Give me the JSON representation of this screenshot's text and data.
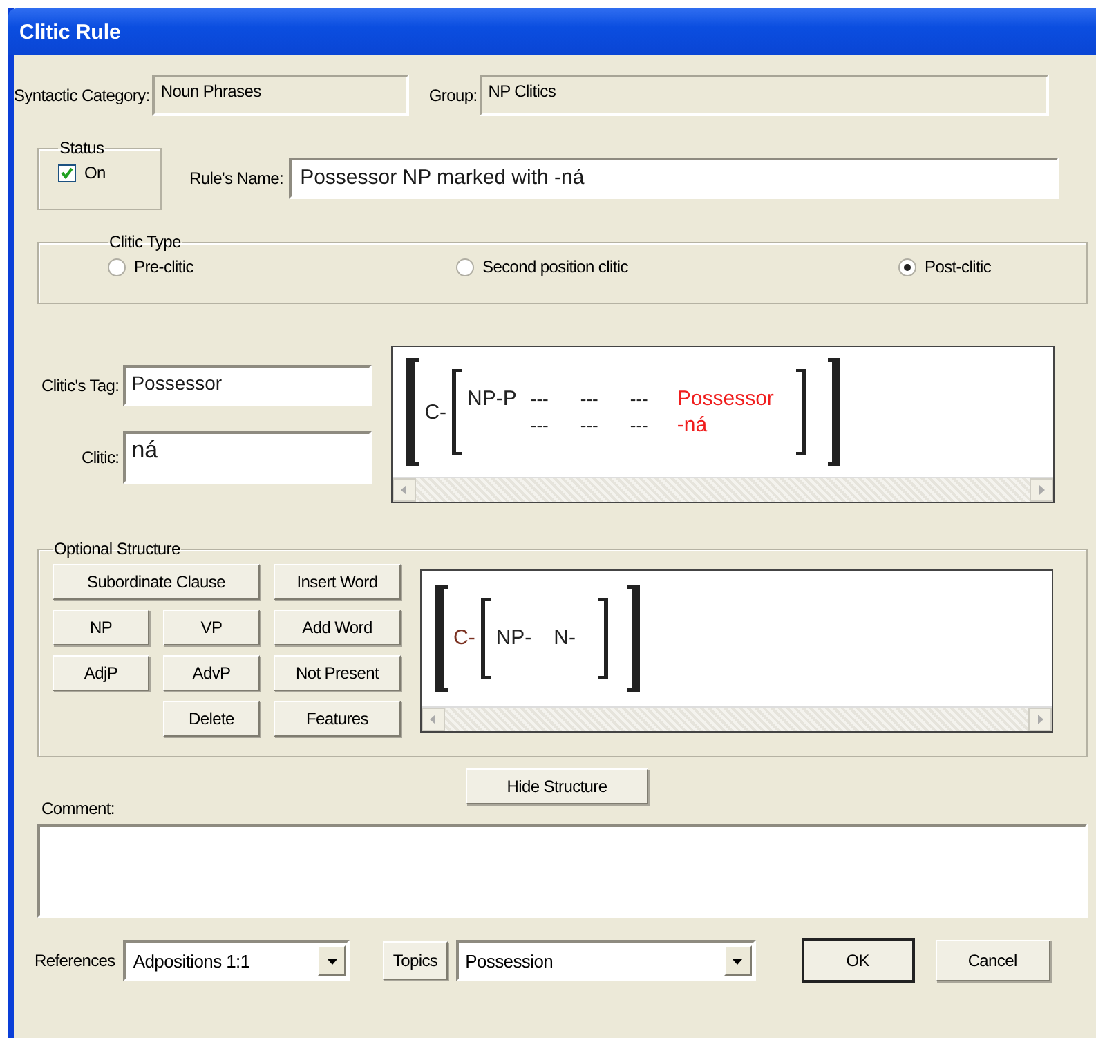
{
  "window": {
    "title": "Clitic Rule"
  },
  "syntactic_category": {
    "label": "Syntactic Category:",
    "value": "Noun Phrases"
  },
  "group": {
    "label": "Group:",
    "value": "NP Clitics"
  },
  "status": {
    "legend": "Status",
    "checkbox": {
      "label": "On",
      "checked": true
    }
  },
  "rule_name": {
    "label": "Rule's Name:",
    "value": "Possessor NP marked with -ná"
  },
  "clitic_type": {
    "legend": "Clitic Type",
    "options": [
      {
        "label": "Pre-clitic",
        "selected": false
      },
      {
        "label": "Second position clitic",
        "selected": false
      },
      {
        "label": "Post-clitic",
        "selected": true
      }
    ]
  },
  "clitic_tag": {
    "label": "Clitic's Tag:",
    "value": "Possessor"
  },
  "clitic": {
    "label": "Clitic:",
    "value": "ná"
  },
  "structure": {
    "outer_label": "C-",
    "phrase_label": "NP-P",
    "rows": [
      {
        "cells": [
          "---",
          "---",
          "---"
        ],
        "word": "Possessor"
      },
      {
        "cells": [
          "---",
          "---",
          "---"
        ],
        "word": "-ná"
      }
    ]
  },
  "optional_structure": {
    "legend": "Optional Structure",
    "buttons": [
      "Subordinate Clause",
      "Insert Word",
      "NP",
      "VP",
      "Add Word",
      "AdjP",
      "AdvP",
      "Not Present",
      "Delete",
      "Features"
    ],
    "structure": {
      "outer_label": "C-",
      "phrase_label": "NP-",
      "head_label": "N-"
    }
  },
  "hide_structure_button": "Hide Structure",
  "comment": {
    "label": "Comment:"
  },
  "references": {
    "label": "References",
    "value": "Adpositions 1:1"
  },
  "topics": {
    "button": "Topics",
    "value": "Possession"
  },
  "buttons": [
    {
      "label": "OK",
      "default": true
    },
    {
      "label": "Cancel",
      "default": false
    }
  ]
}
